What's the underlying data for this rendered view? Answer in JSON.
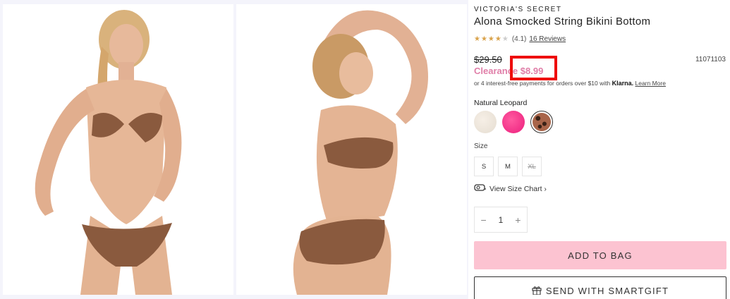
{
  "product": {
    "brand": "VICTORIA'S SECRET",
    "title": "Alona Smocked String Bikini Bottom",
    "rating_value": "(4.1)",
    "rating_stars": 4,
    "reviews_link": "16 Reviews",
    "original_price": "$29.50",
    "sku": "11071103",
    "sale_price": "Clearance $8.99",
    "klarna_text": "or 4 interest-free payments for orders over $10 with",
    "klarna_logo": "Klarna.",
    "klarna_learn_more": "Learn More"
  },
  "color": {
    "label": "Natural Leopard",
    "swatches": [
      "cream",
      "pink",
      "leopard"
    ],
    "selected": "leopard"
  },
  "size": {
    "label": "Size",
    "options": [
      "S",
      "M",
      "XL"
    ],
    "unavailable": [
      "XL"
    ]
  },
  "size_chart_link": "View Size Chart ›",
  "quantity": {
    "minus": "−",
    "value": "1",
    "plus": "+"
  },
  "actions": {
    "add_to_bag": "ADD TO BAG",
    "send_gift": "SEND WITH SMARTGIFT"
  },
  "colors": {
    "clearance": "#e07ea8",
    "add_to_bag_bg": "#fcc3d1",
    "highlight_box": "#ee0a0a"
  }
}
